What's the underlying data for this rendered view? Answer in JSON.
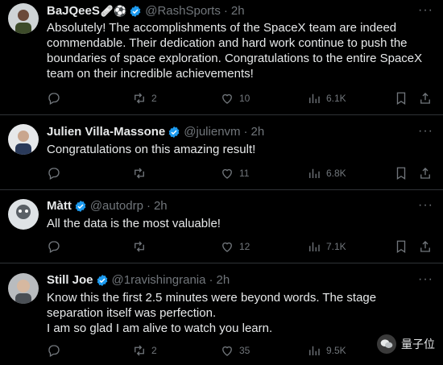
{
  "tweets": [
    {
      "name": "BaJQeeS",
      "name_emoji": "🩹⚽",
      "handle": "@RashSports",
      "time": "2h",
      "text": "Absolutely! The accomplishments of the SpaceX team are indeed commendable. Their dedication and hard work continue to push the boundaries of space exploration. Congratulations to the entire SpaceX team on their incredible achievements!",
      "reply_count": "",
      "retweet_count": "2",
      "like_count": "10",
      "view_count": "6.1K"
    },
    {
      "name": "Julien Villa-Massone",
      "handle": "@julienvm",
      "time": "2h",
      "text": "Congratulations on this amazing result!",
      "reply_count": "",
      "retweet_count": "",
      "like_count": "11",
      "view_count": "6.8K"
    },
    {
      "name": "Màtt",
      "handle": "@autodrp",
      "time": "2h",
      "text": "All the data is the most valuable!",
      "reply_count": "",
      "retweet_count": "",
      "like_count": "12",
      "view_count": "7.1K"
    },
    {
      "name": "Still Joe",
      "handle": "@1ravishingrania",
      "time": "2h",
      "text": "Know this the first 2.5 minutes were beyond words. The stage separation itself was perfection.\nI am so glad I am alive to watch you learn.",
      "reply_count": "",
      "retweet_count": "2",
      "like_count": "35",
      "view_count": "9.5K"
    }
  ],
  "watermark": {
    "text": "量子位"
  },
  "colors": {
    "background": "#000000",
    "verified": "#1d9bf0",
    "muted": "#71767b",
    "text": "#e7e9ea",
    "divider": "#2f3336"
  },
  "icons": [
    "reply-icon",
    "retweet-icon",
    "like-icon",
    "views-icon",
    "bookmark-icon",
    "share-icon",
    "verified-badge-icon",
    "more-icon"
  ]
}
